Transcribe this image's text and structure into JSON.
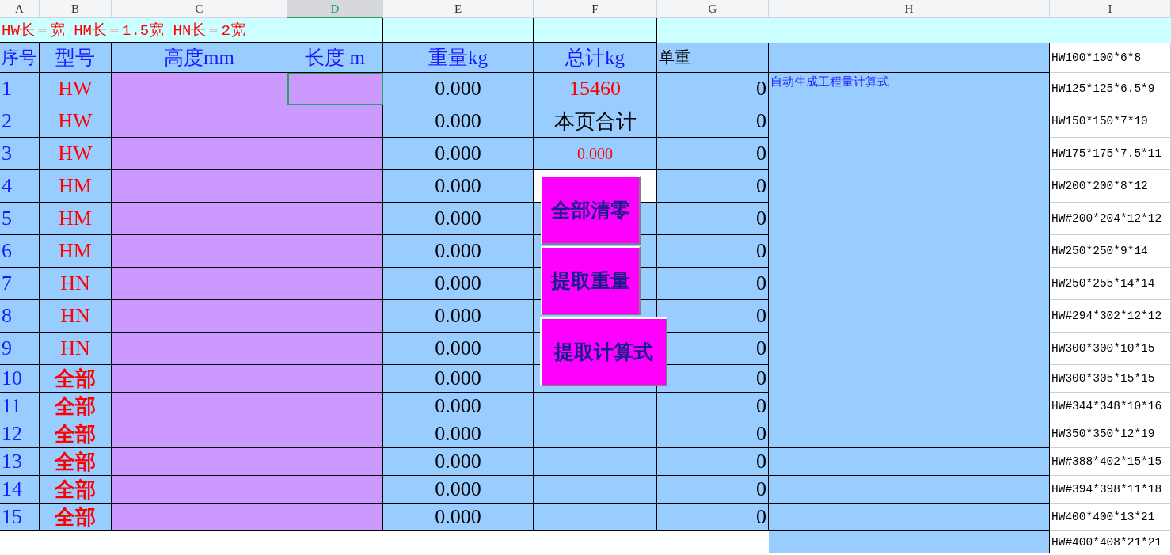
{
  "column_headers": [
    {
      "label": "A",
      "selected": false
    },
    {
      "label": "B",
      "selected": false
    },
    {
      "label": "C",
      "selected": false
    },
    {
      "label": "D",
      "selected": true
    },
    {
      "label": "E",
      "selected": false
    },
    {
      "label": "F",
      "selected": false
    },
    {
      "label": "G",
      "selected": false
    },
    {
      "label": "H",
      "selected": false
    },
    {
      "label": "I",
      "selected": false
    }
  ],
  "note": "HW长＝宽 HM长＝1.5宽 HN长＝2宽",
  "headers": [
    "序号",
    "型号",
    "高度mm",
    "长度 m",
    "重量kg",
    "总计kg",
    "单重"
  ],
  "rows": [
    {
      "no": "1",
      "type": "HW",
      "weight": "0.000",
      "unit_weight": "0",
      "length_selected": true
    },
    {
      "no": "2",
      "type": "HW",
      "weight": "0.000",
      "unit_weight": "0",
      "length_selected": false
    },
    {
      "no": "3",
      "type": "HW",
      "weight": "0.000",
      "unit_weight": "0",
      "length_selected": false
    },
    {
      "no": "4",
      "type": "HM",
      "weight": "0.000",
      "unit_weight": "0",
      "length_selected": false
    },
    {
      "no": "5",
      "type": "HM",
      "weight": "0.000",
      "unit_weight": "0",
      "length_selected": false
    },
    {
      "no": "6",
      "type": "HM",
      "weight": "0.000",
      "unit_weight": "0",
      "length_selected": false
    },
    {
      "no": "7",
      "type": "HN",
      "weight": "0.000",
      "unit_weight": "0",
      "length_selected": false
    },
    {
      "no": "8",
      "type": "HN",
      "weight": "0.000",
      "unit_weight": "0",
      "length_selected": false
    },
    {
      "no": "9",
      "type": "HN",
      "weight": "0.000",
      "unit_weight": "0",
      "length_selected": false
    },
    {
      "no": "10",
      "type": "全部",
      "weight": "0.000",
      "unit_weight": "0",
      "length_selected": false
    },
    {
      "no": "11",
      "type": "全部",
      "weight": "0.000",
      "unit_weight": "0",
      "length_selected": false
    },
    {
      "no": "12",
      "type": "全部",
      "weight": "0.000",
      "unit_weight": "0",
      "length_selected": false
    },
    {
      "no": "13",
      "type": "全部",
      "weight": "0.000",
      "unit_weight": "0",
      "length_selected": false
    },
    {
      "no": "14",
      "type": "全部",
      "weight": "0.000",
      "unit_weight": "0",
      "length_selected": false
    },
    {
      "no": "15",
      "type": "全部",
      "weight": "0.000",
      "unit_weight": "0",
      "length_selected": false
    }
  ],
  "total": "15460",
  "page_total_label": "本页合计",
  "page_total": "0.000",
  "formula_label": "自动生成工程量计算式",
  "sections": [
    "HW100*100*6*8",
    "HW125*125*6.5*9",
    "HW150*150*7*10",
    "HW175*175*7.5*11",
    "HW200*200*8*12",
    "HW#200*204*12*12",
    "HW250*250*9*14",
    "HW250*255*14*14",
    "HW#294*302*12*12",
    "HW300*300*10*15",
    "HW300*305*15*15",
    "HW#344*348*10*16",
    "HW350*350*12*19",
    "HW#388*402*15*15",
    "HW#394*398*11*18",
    "HW400*400*13*21",
    "HW#400*408*21*21"
  ],
  "buttons": [
    "全部清零",
    "提取重量",
    "提取计算式"
  ]
}
